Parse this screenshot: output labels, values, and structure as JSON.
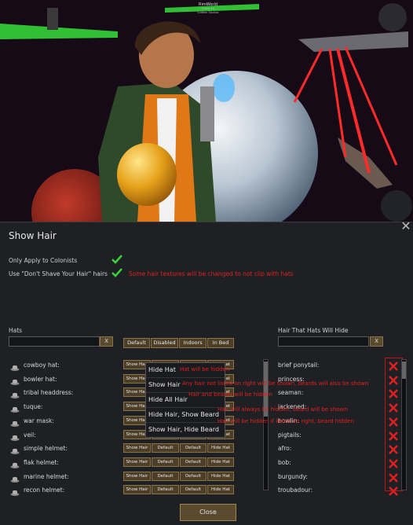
{
  "background": {
    "logo_lines": [
      "RimWorld",
      "Alpha 18",
      "Ludeon Studios"
    ]
  },
  "dialog": {
    "title": "Show Hair",
    "options": [
      {
        "label": "Only Apply to Colonists",
        "checked": true,
        "note": ""
      },
      {
        "label": "Use \"Don't Shave Your Hair\" hairs",
        "checked": true,
        "note": "Some hair textures will be changed to not clip with hats"
      }
    ],
    "hats_label": "Hats",
    "hair_label": "Hair That Hats Will Hide",
    "search_clear": "X",
    "column_buttons": [
      "Default",
      "Disabled",
      "Indoors",
      "In Bed"
    ],
    "hats": [
      {
        "name": "cowboy hat:",
        "icon": "cowboy-hat-icon"
      },
      {
        "name": "bowler hat:",
        "icon": "bowler-hat-icon"
      },
      {
        "name": "tribal headdress:",
        "icon": "tribal-headdress-icon"
      },
      {
        "name": "tuque:",
        "icon": "tuque-icon"
      },
      {
        "name": "war mask:",
        "icon": "war-mask-icon"
      },
      {
        "name": "veil:",
        "icon": "veil-icon"
      },
      {
        "name": "simple helmet:",
        "icon": "simple-helmet-icon"
      },
      {
        "name": "flak helmet:",
        "icon": "flak-helmet-icon"
      },
      {
        "name": "marine helmet:",
        "icon": "marine-helmet-icon"
      },
      {
        "name": "recon helmet:",
        "icon": "recon-helmet-icon"
      }
    ],
    "row_buttons": [
      "Show Hair",
      "Default",
      "Default",
      "Hide Hat"
    ],
    "dropdown": [
      {
        "label": "Hide Hat",
        "note": "Hat will be hidden"
      },
      {
        "label": "Show Hair",
        "note": "Any hair not listed on right will be shown, beards will also be shown"
      },
      {
        "label": "Hide All Hair",
        "note": "Hair and beards will be hidden"
      },
      {
        "label": "Hide Hair, Show Beard",
        "note": "Hair will always be hidden, beard will be shown"
      },
      {
        "label": "Show Hair, Hide Beard",
        "note": "Hair will be hidden if listed on right, beard hidden"
      }
    ],
    "hairs": [
      "brief ponytail:",
      "princess:",
      "seaman:",
      "jackened:",
      "bowlin:",
      "pigtails:",
      "afro:",
      "bob:",
      "burgundy:",
      "troubadour:"
    ],
    "close_label": "Close",
    "close_icon": "x-icon",
    "accent_red": "#e02020"
  }
}
